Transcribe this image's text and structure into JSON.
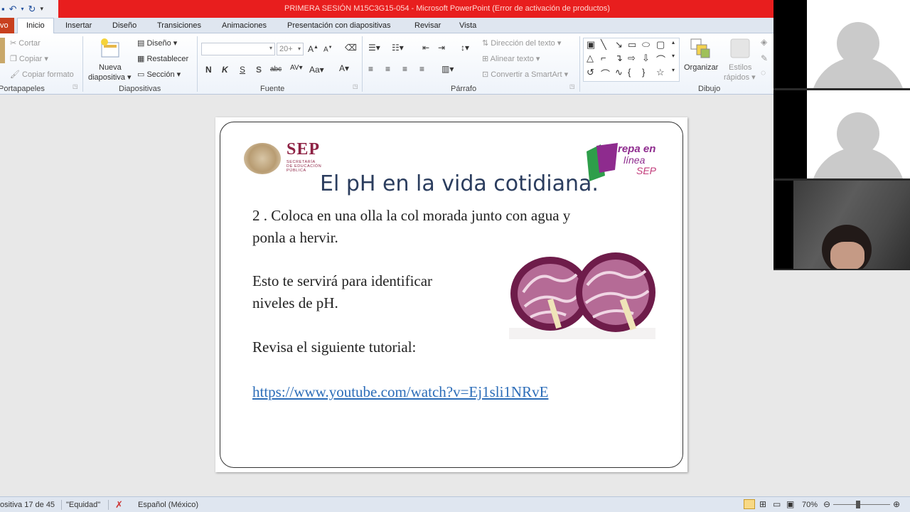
{
  "window": {
    "title": "PRIMERA SESIÓN M15C3G15-054  -  Microsoft PowerPoint (Error de activación de productos)"
  },
  "tabs": {
    "file": "vo",
    "items": [
      "Inicio",
      "Insertar",
      "Diseño",
      "Transiciones",
      "Animaciones",
      "Presentación con diapositivas",
      "Revisar",
      "Vista"
    ],
    "active": "Inicio"
  },
  "ribbon": {
    "clipboard": {
      "cut": "Cortar",
      "copy": "Copiar",
      "format_painter": "Copiar formato",
      "label": "Portapapeles"
    },
    "slides": {
      "new_slide_line1": "Nueva",
      "new_slide_line2": "diapositiva",
      "layout": "Diseño",
      "reset": "Restablecer",
      "section": "Sección",
      "label": "Diapositivas"
    },
    "font": {
      "size": "20+",
      "label": "Fuente",
      "bold": "N",
      "italic": "K",
      "underline": "S",
      "shadow": "S",
      "strike": "abc"
    },
    "paragraph": {
      "text_direction": "Dirección del texto",
      "align_text": "Alinear texto",
      "smartart": "Convertir a SmartArt",
      "label": "Párrafo"
    },
    "drawing": {
      "arrange": "Organizar",
      "quick_styles_line1": "Estilos",
      "quick_styles_line2": "rápidos",
      "label": "Dibujo"
    }
  },
  "slide": {
    "logo_text": "SEP",
    "logo_sub": [
      "SECRETARÍA",
      "DE EDUCACIÓN",
      "PÚBLICA"
    ],
    "prepa_line1": "repa en",
    "prepa_line2": "línea",
    "prepa_line3": "SEP",
    "title": "El pH en la vida cotidiana.",
    "step_line1": "2 . Coloca en una olla la col morada junto con agua y",
    "step_line2": "ponla a hervir.",
    "note_line1": "Esto te servirá para identificar",
    "note_line2": "niveles de pH.",
    "tutorial": "Revisa el siguiente tutorial:",
    "link": "https://www.youtube.com/watch?v=Ej1sli1NRvE"
  },
  "statusbar": {
    "slide_count": "ositiva 17 de 45",
    "theme": "\"Equidad\"",
    "language": "Español (México)",
    "zoom": "70%"
  },
  "colors": {
    "titlebar": "#e81e1e",
    "sep_maroon": "#8e2244",
    "title_blue": "#2b3d5e",
    "link_blue": "#2b6cb8"
  }
}
